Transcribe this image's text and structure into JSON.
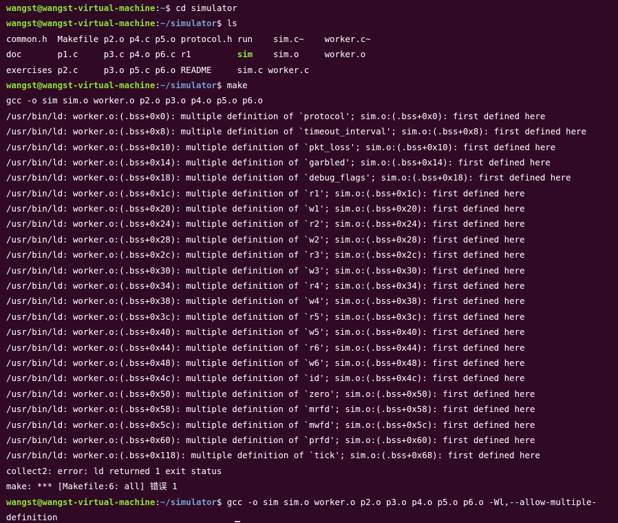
{
  "colors": {
    "background": "#300a24",
    "text": "#ffffff",
    "prompt_user": "#8ae234",
    "prompt_path": "#729fcf",
    "executable": "#8ae234"
  },
  "prompt": {
    "user_host": "wangst@wangst-virtual-machine",
    "sep": ":",
    "path": "~/simulator",
    "home_path": "~",
    "dollar": "$"
  },
  "lines": [
    {
      "kind": "prompt",
      "path": "~",
      "command": " cd simulator"
    },
    {
      "kind": "prompt",
      "path": "~/simulator",
      "command": " ls"
    },
    {
      "kind": "ls",
      "cells": [
        "common.h  ",
        "Makefile ",
        "p2.o ",
        "p4.c ",
        "p5.o ",
        "protocol.h ",
        "run  ",
        "  sim.c~  ",
        "  worker.c~"
      ]
    },
    {
      "kind": "ls2",
      "cells": [
        "doc       ",
        "p1.c     ",
        "p3.c ",
        "p4.o ",
        "p6.c ",
        "r1         ",
        "sim",
        "  ",
        "  sim.o   ",
        "  worker.o"
      ]
    },
    {
      "kind": "ls",
      "cells": [
        "exercises ",
        "p2.c     ",
        "p3.o ",
        "p5.c ",
        "p6.o ",
        "README     ",
        "sim.c",
        " ",
        "worker.c"
      ]
    },
    {
      "kind": "prompt",
      "path": "~/simulator",
      "command": " make"
    },
    {
      "kind": "text",
      "text": "gcc -o sim sim.o worker.o p2.o p3.o p4.o p5.o p6.o"
    },
    {
      "kind": "text",
      "text": "/usr/bin/ld: worker.o:(.bss+0x0): multiple definition of `protocol'; sim.o:(.bss+0x0): first defined here"
    },
    {
      "kind": "text",
      "text": "/usr/bin/ld: worker.o:(.bss+0x8): multiple definition of `timeout_interval'; sim.o:(.bss+0x8): first defined here"
    },
    {
      "kind": "text",
      "text": "/usr/bin/ld: worker.o:(.bss+0x10): multiple definition of `pkt_loss'; sim.o:(.bss+0x10): first defined here"
    },
    {
      "kind": "text",
      "text": "/usr/bin/ld: worker.o:(.bss+0x14): multiple definition of `garbled'; sim.o:(.bss+0x14): first defined here"
    },
    {
      "kind": "text",
      "text": "/usr/bin/ld: worker.o:(.bss+0x18): multiple definition of `debug_flags'; sim.o:(.bss+0x18): first defined here"
    },
    {
      "kind": "text",
      "text": "/usr/bin/ld: worker.o:(.bss+0x1c): multiple definition of `r1'; sim.o:(.bss+0x1c): first defined here"
    },
    {
      "kind": "text",
      "text": "/usr/bin/ld: worker.o:(.bss+0x20): multiple definition of `w1'; sim.o:(.bss+0x20): first defined here"
    },
    {
      "kind": "text",
      "text": "/usr/bin/ld: worker.o:(.bss+0x24): multiple definition of `r2'; sim.o:(.bss+0x24): first defined here"
    },
    {
      "kind": "text",
      "text": "/usr/bin/ld: worker.o:(.bss+0x28): multiple definition of `w2'; sim.o:(.bss+0x28): first defined here"
    },
    {
      "kind": "text",
      "text": "/usr/bin/ld: worker.o:(.bss+0x2c): multiple definition of `r3'; sim.o:(.bss+0x2c): first defined here"
    },
    {
      "kind": "text",
      "text": "/usr/bin/ld: worker.o:(.bss+0x30): multiple definition of `w3'; sim.o:(.bss+0x30): first defined here"
    },
    {
      "kind": "text",
      "text": "/usr/bin/ld: worker.o:(.bss+0x34): multiple definition of `r4'; sim.o:(.bss+0x34): first defined here"
    },
    {
      "kind": "text",
      "text": "/usr/bin/ld: worker.o:(.bss+0x38): multiple definition of `w4'; sim.o:(.bss+0x38): first defined here"
    },
    {
      "kind": "text",
      "text": "/usr/bin/ld: worker.o:(.bss+0x3c): multiple definition of `r5'; sim.o:(.bss+0x3c): first defined here"
    },
    {
      "kind": "text",
      "text": "/usr/bin/ld: worker.o:(.bss+0x40): multiple definition of `w5'; sim.o:(.bss+0x40): first defined here"
    },
    {
      "kind": "text",
      "text": "/usr/bin/ld: worker.o:(.bss+0x44): multiple definition of `r6'; sim.o:(.bss+0x44): first defined here"
    },
    {
      "kind": "text",
      "text": "/usr/bin/ld: worker.o:(.bss+0x48): multiple definition of `w6'; sim.o:(.bss+0x48): first defined here"
    },
    {
      "kind": "text",
      "text": "/usr/bin/ld: worker.o:(.bss+0x4c): multiple definition of `id'; sim.o:(.bss+0x4c): first defined here"
    },
    {
      "kind": "text",
      "text": "/usr/bin/ld: worker.o:(.bss+0x50): multiple definition of `zero'; sim.o:(.bss+0x50): first defined here"
    },
    {
      "kind": "text",
      "text": "/usr/bin/ld: worker.o:(.bss+0x58): multiple definition of `mrfd'; sim.o:(.bss+0x58): first defined here"
    },
    {
      "kind": "text",
      "text": "/usr/bin/ld: worker.o:(.bss+0x5c): multiple definition of `mwfd'; sim.o:(.bss+0x5c): first defined here"
    },
    {
      "kind": "text",
      "text": "/usr/bin/ld: worker.o:(.bss+0x60): multiple definition of `prfd'; sim.o:(.bss+0x60): first defined here"
    },
    {
      "kind": "text",
      "text": "/usr/bin/ld: worker.o:(.bss+0x118): multiple definition of `tick'; sim.o:(.bss+0x68): first defined here"
    },
    {
      "kind": "text",
      "text": "collect2: error: ld returned 1 exit status"
    },
    {
      "kind": "text",
      "text": "make: *** [Makefile:6: all] 错误 1"
    },
    {
      "kind": "prompt",
      "path": "~/simulator",
      "command": " gcc -o sim sim.o worker.o p2.o p3.o p4.o p5.o p6.o -Wl,--allow-multiple-"
    },
    {
      "kind": "text",
      "text": "definition"
    }
  ]
}
